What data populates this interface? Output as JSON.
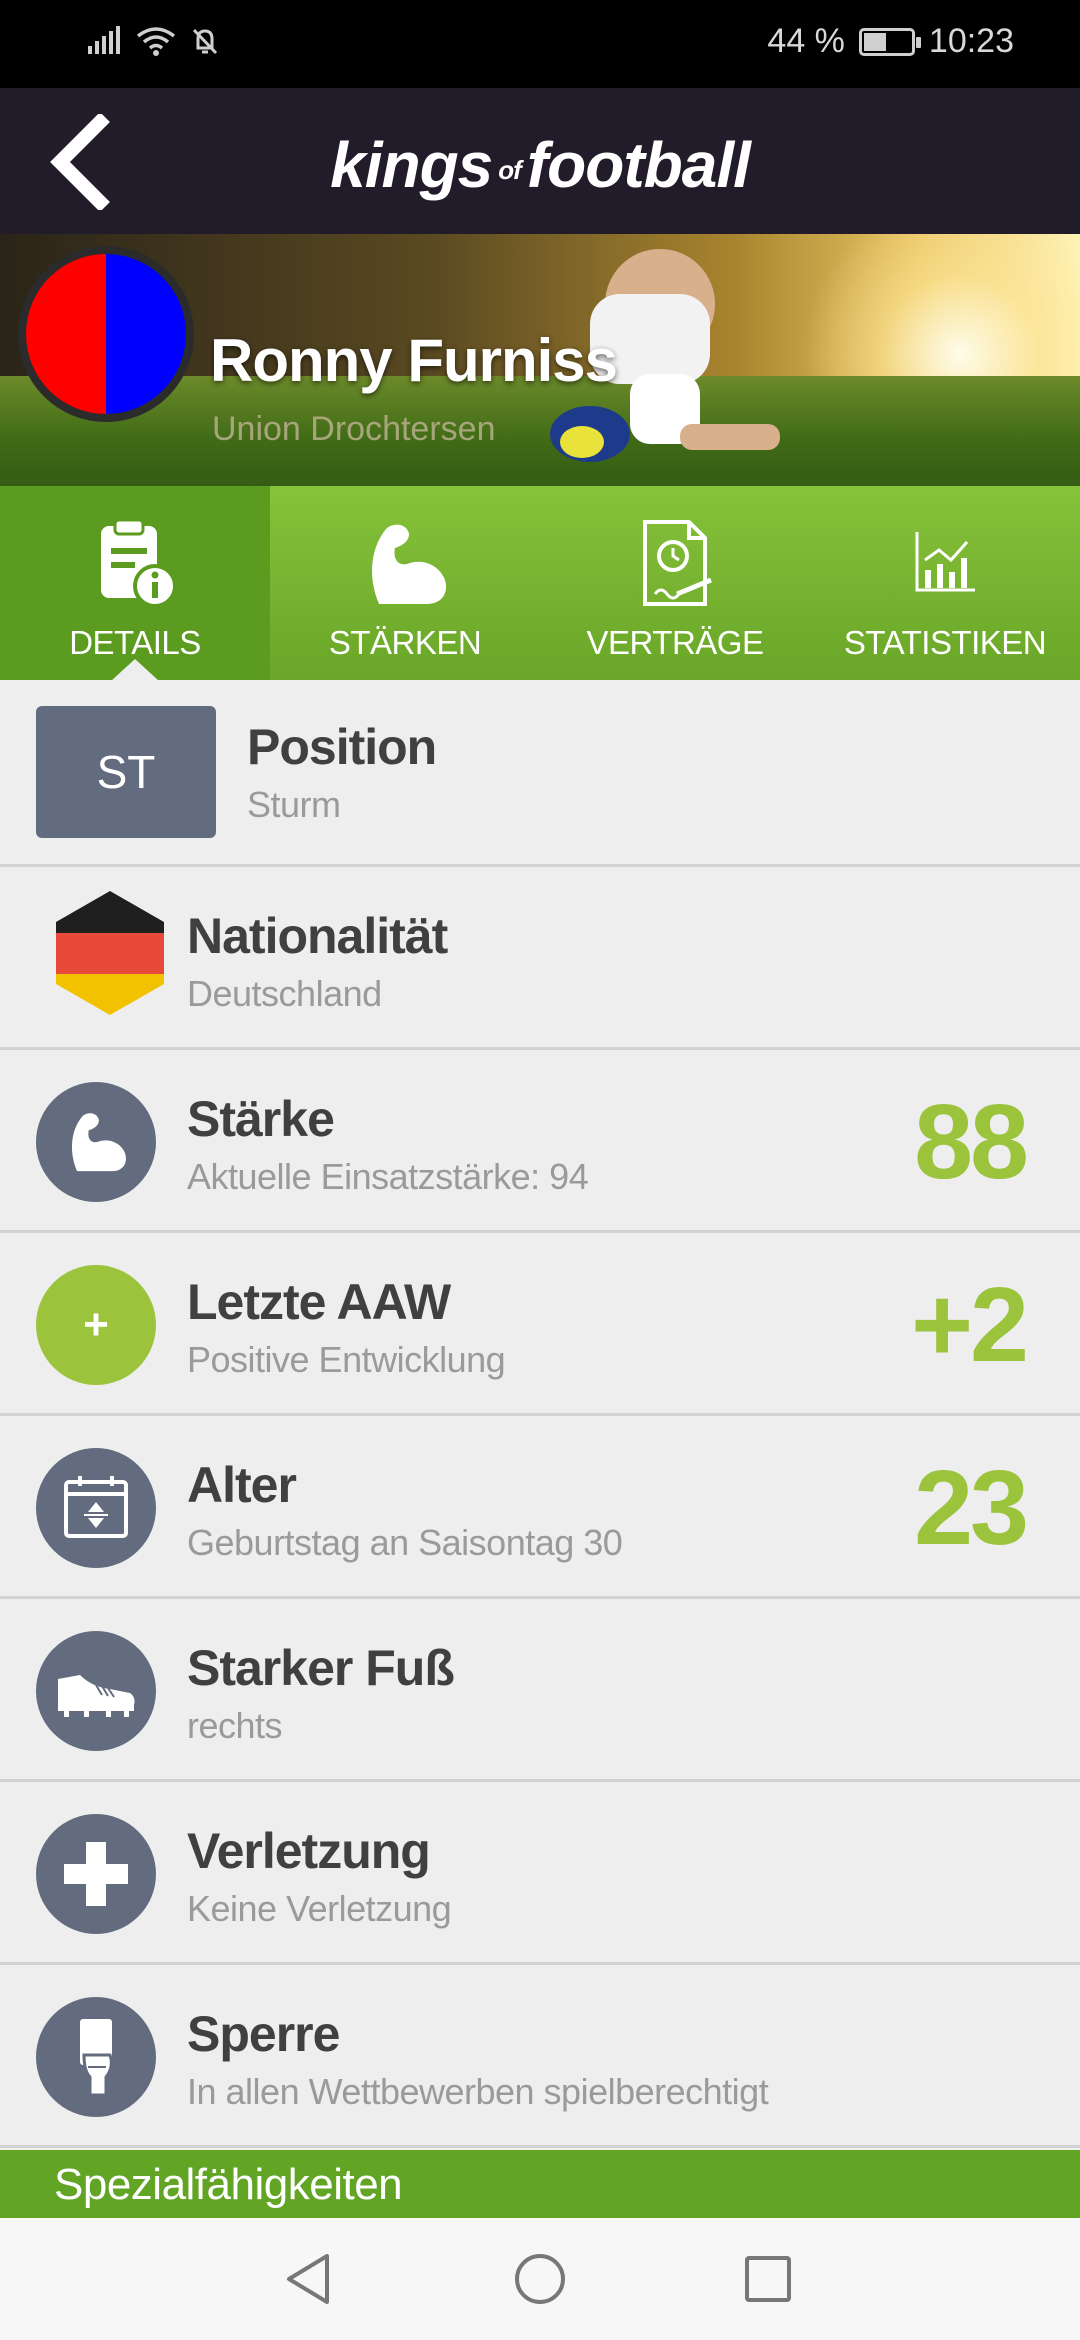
{
  "statusbar": {
    "battery_text": "44 %",
    "time": "10:23",
    "battery_level": 0.44
  },
  "appbar": {
    "logo_main": "kings",
    "logo_of": "of",
    "logo_end": "football"
  },
  "player": {
    "name": "Ronny Furniss",
    "club": "Union Drochtersen",
    "club_colors": [
      "#ff0000",
      "#0000ff"
    ]
  },
  "tabs": [
    {
      "label": "DETAILS",
      "icon": "document-info-icon",
      "active": true
    },
    {
      "label": "STÄRKEN",
      "icon": "muscle-arm-icon",
      "active": false
    },
    {
      "label": "VERTRÄGE",
      "icon": "contract-clock-icon",
      "active": false
    },
    {
      "label": "STATISTIKEN",
      "icon": "chart-icon",
      "active": false
    }
  ],
  "rows": {
    "position": {
      "badge": "ST",
      "title": "Position",
      "subtitle": "Sturm"
    },
    "nationality": {
      "title": "Nationalität",
      "subtitle": "Deutschland",
      "flag_colors": [
        "#1f1f1f",
        "#e84a3a",
        "#f2c200"
      ]
    },
    "strength": {
      "title": "Stärke",
      "subtitle": "Aktuelle Einsatzstärke: 94",
      "value": "88"
    },
    "last_aaw": {
      "title": "Letzte AAW",
      "subtitle": "Positive Entwicklung",
      "value": "+2",
      "icon_symbol": "+"
    },
    "age": {
      "title": "Alter",
      "subtitle": "Geburtstag an Saisontag 30",
      "value": "23"
    },
    "foot": {
      "title": "Starker Fuß",
      "subtitle": "rechts"
    },
    "injury": {
      "title": "Verletzung",
      "subtitle": "Keine Verletzung"
    },
    "ban": {
      "title": "Sperre",
      "subtitle": "In allen Wettbewerben spielberechtigt"
    }
  },
  "special": {
    "label": "Spezialfähigkeiten"
  },
  "colors": {
    "accent_green": "#9bc33b",
    "tab_green": "#6aa628",
    "icon_slate": "#636c7e",
    "appbar": "#211b2a"
  }
}
